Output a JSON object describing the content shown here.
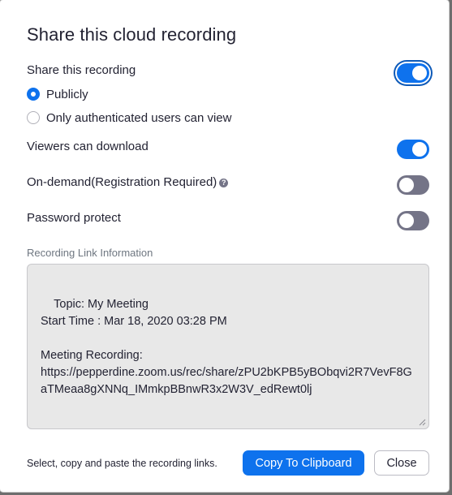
{
  "dialog": {
    "title": "Share this cloud recording"
  },
  "share": {
    "label": "Share this recording",
    "enabled": true,
    "options": [
      {
        "label": "Publicly",
        "checked": true
      },
      {
        "label": "Only authenticated users can view",
        "checked": false
      }
    ]
  },
  "settings": {
    "viewers_download": {
      "label": "Viewers can download",
      "enabled": true
    },
    "on_demand": {
      "label": "On-demand(Registration Required)",
      "enabled": false,
      "help_icon": "?"
    },
    "password": {
      "label": "Password protect",
      "enabled": false
    }
  },
  "link_info": {
    "section_label": "Recording Link Information",
    "content": "Topic: My Meeting\nStart Time : Mar 18, 2020 03:28 PM\n\nMeeting Recording:\nhttps://pepperdine.zoom.us/rec/share/zPU2bKPB5yBObqvi2R7VevF8GaTMeaa8gXNNq_IMmkpBBnwR3x2W3V_edRewt0lj"
  },
  "footer": {
    "hint": "Select, copy and paste the recording links.",
    "copy_label": "Copy To Clipboard",
    "close_label": "Close"
  },
  "colors": {
    "accent": "#0e72ed",
    "toggle_off": "#747487",
    "text": "#232333"
  }
}
